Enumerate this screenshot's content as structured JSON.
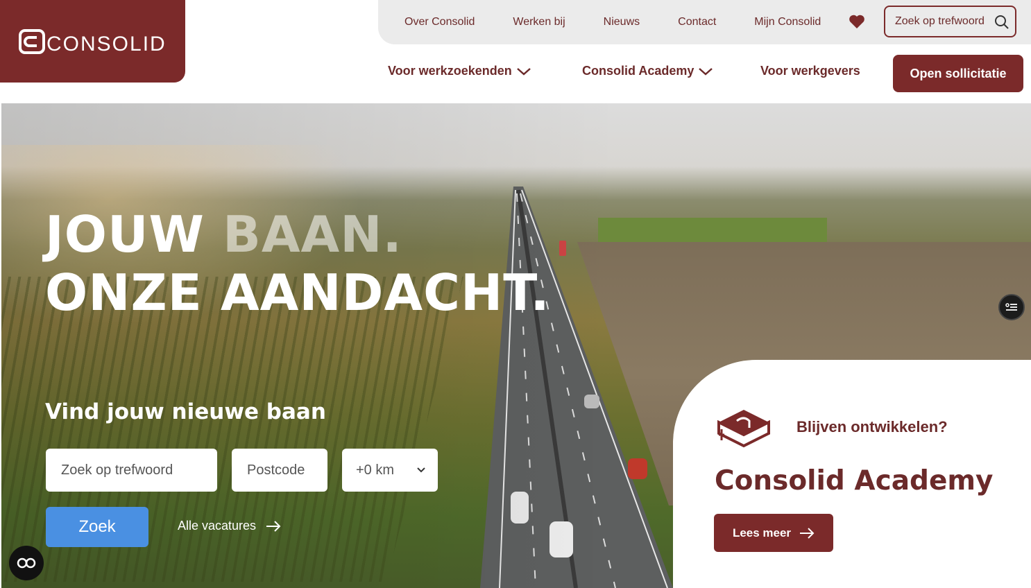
{
  "brand": {
    "logo_text": "CONSOLID",
    "primary_color": "#7b2a2a",
    "accent_color": "#4a90e2"
  },
  "topbar": {
    "links": [
      "Over Consolid",
      "Werken bij",
      "Nieuws",
      "Contact",
      "Mijn Consolid"
    ],
    "favorites_icon": "heart-icon",
    "search_placeholder": "Zoek op trefwoord"
  },
  "mainnav": {
    "items": [
      {
        "label": "Voor werkzoekenden",
        "has_dropdown": true
      },
      {
        "label": "Consolid Academy",
        "has_dropdown": true
      },
      {
        "label": "Voor werkgevers",
        "has_dropdown": false
      }
    ],
    "cta": "Open sollicitatie"
  },
  "hero": {
    "headline_line1_a": "JOUW ",
    "headline_line1_b": "BAAN.",
    "headline_line2": "ONZE AANDACHT.",
    "search_title": "Vind jouw nieuwe baan",
    "keyword_placeholder": "Zoek op trefwoord",
    "postcode_placeholder": "Postcode",
    "distance_value": "+0 km",
    "search_button": "Zoek",
    "all_jobs_link": "Alle vacatures"
  },
  "academy": {
    "subtitle": "Blijven ontwikkelen?",
    "title": "Consolid Academy",
    "button": "Lees meer"
  }
}
